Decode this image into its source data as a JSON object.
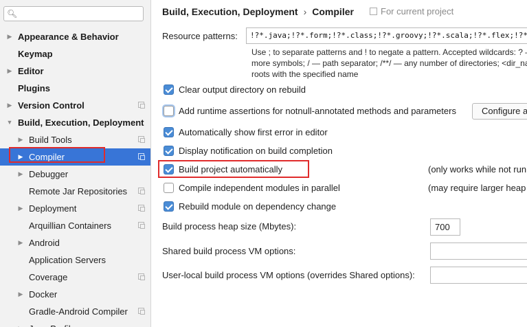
{
  "sidebar": {
    "search": {
      "placeholder": ""
    },
    "items": [
      {
        "label": "Appearance & Behavior"
      },
      {
        "label": "Keymap"
      },
      {
        "label": "Editor"
      },
      {
        "label": "Plugins"
      },
      {
        "label": "Version Control"
      },
      {
        "label": "Build, Execution, Deployment"
      },
      {
        "label": "Build Tools"
      },
      {
        "label": "Compiler"
      },
      {
        "label": "Debugger"
      },
      {
        "label": "Remote Jar Repositories"
      },
      {
        "label": "Deployment"
      },
      {
        "label": "Arquillian Containers"
      },
      {
        "label": "Android"
      },
      {
        "label": "Application Servers"
      },
      {
        "label": "Coverage"
      },
      {
        "label": "Docker"
      },
      {
        "label": "Gradle-Android Compiler"
      },
      {
        "label": "Java Profiler"
      }
    ]
  },
  "header": {
    "breadcrumb_parent": "Build, Execution, Deployment",
    "breadcrumb_separator": "›",
    "breadcrumb_current": "Compiler",
    "scope": "For current project"
  },
  "resource_patterns": {
    "label": "Resource patterns:",
    "value": "!?*.java;!?*.form;!?*.class;!?*.groovy;!?*.scala;!?*.flex;!?*.kt;!?*.clj",
    "hint_line1": "Use ; to separate patterns and ! to negate a pattern. Accepted wildcards: ? —",
    "hint_line2": "more symbols; / — path separator; /**/ — any number of directories; <dir_na",
    "hint_line3": "roots with the specified name"
  },
  "options": [
    {
      "label": "Clear output directory on rebuild",
      "checked": true
    },
    {
      "label": "Add runtime assertions for notnull-annotated methods and parameters",
      "checked": false
    },
    {
      "label": "Automatically show first error in editor",
      "checked": true
    },
    {
      "label": "Display notification on build completion",
      "checked": true
    },
    {
      "label": "Build project automatically",
      "checked": true,
      "note": "(only works while not run"
    },
    {
      "label": "Compile independent modules in parallel",
      "checked": false,
      "note": "(may require larger heap"
    },
    {
      "label": "Rebuild module on dependency change",
      "checked": true
    }
  ],
  "configure_button": {
    "label": "Configure a"
  },
  "heap": {
    "label": "Build process heap size (Mbytes):",
    "value": "700"
  },
  "shared_vm": {
    "label": "Shared build process VM options:",
    "value": ""
  },
  "user_vm": {
    "label": "User-local build process VM options (overrides Shared options):",
    "value": ""
  }
}
